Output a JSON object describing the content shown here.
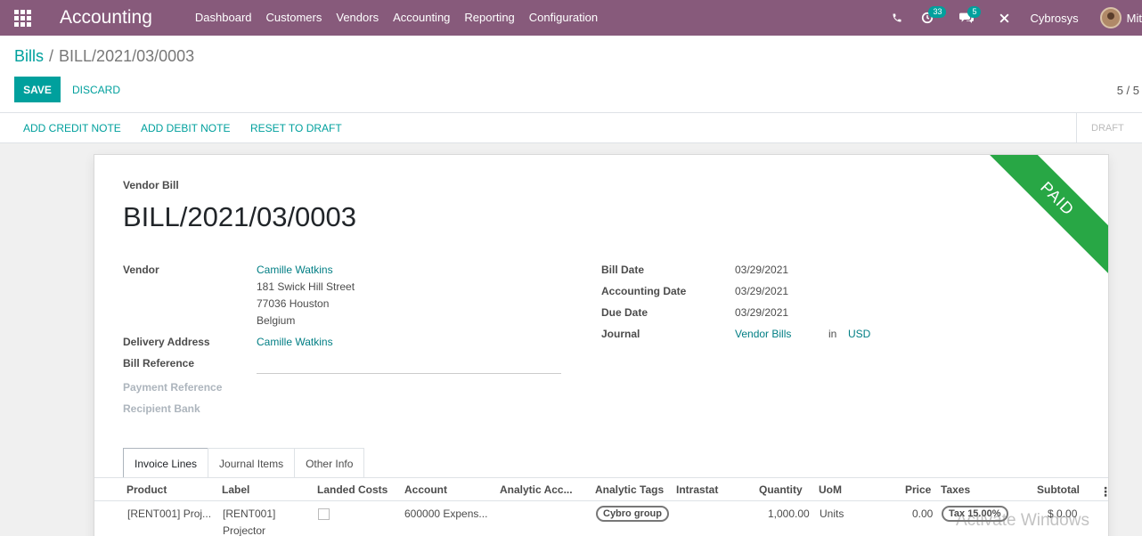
{
  "navbar": {
    "app_title": "Accounting",
    "menu": [
      "Dashboard",
      "Customers",
      "Vendors",
      "Accounting",
      "Reporting",
      "Configuration"
    ],
    "activity_count": "33",
    "message_count": "5",
    "company": "Cybrosys",
    "user": "Mit"
  },
  "breadcrumb": {
    "parent": "Bills",
    "separator": "/",
    "current": "BILL/2021/03/0003"
  },
  "actions": {
    "save": "SAVE",
    "discard": "DISCARD",
    "pager": "5 / 5"
  },
  "statusbar": {
    "credit_note": "ADD CREDIT NOTE",
    "debit_note": "ADD DEBIT NOTE",
    "reset": "RESET TO DRAFT",
    "stage": "DRAFT"
  },
  "sheet": {
    "ribbon": "PAID",
    "type": "Vendor Bill",
    "title": "BILL/2021/03/0003",
    "labels": {
      "vendor": "Vendor",
      "delivery": "Delivery Address",
      "bill_ref": "Bill Reference",
      "payment_ref": "Payment Reference",
      "recipient_bank": "Recipient Bank",
      "bill_date": "Bill Date",
      "accounting_date": "Accounting Date",
      "due_date": "Due Date",
      "journal": "Journal"
    },
    "vendor": {
      "name": "Camille Watkins",
      "street": "181 Swick Hill Street",
      "city": "77036 Houston",
      "country": "Belgium"
    },
    "delivery_address": "Camille Watkins",
    "bill_date": "03/29/2021",
    "accounting_date": "03/29/2021",
    "due_date": "03/29/2021",
    "journal": "Vendor Bills",
    "journal_in": "in",
    "currency": "USD"
  },
  "tabs": [
    "Invoice Lines",
    "Journal Items",
    "Other Info"
  ],
  "table": {
    "headers": [
      "Product",
      "Label",
      "Landed Costs",
      "Account",
      "Analytic Acc...",
      "Analytic Tags",
      "Intrastat",
      "Quantity",
      "UoM",
      "Price",
      "Taxes",
      "Subtotal"
    ],
    "row": {
      "product": "[RENT001] Proj...",
      "label_line1": "[RENT001]",
      "label_line2": "Projector",
      "account": "600000 Expens...",
      "tag": "Cybro group",
      "quantity": "1,000.00",
      "uom": "Units",
      "price": "0.00",
      "tax": "Tax 15.00%",
      "subtotal": "$ 0.00"
    }
  },
  "watermark": "Activate Windows"
}
